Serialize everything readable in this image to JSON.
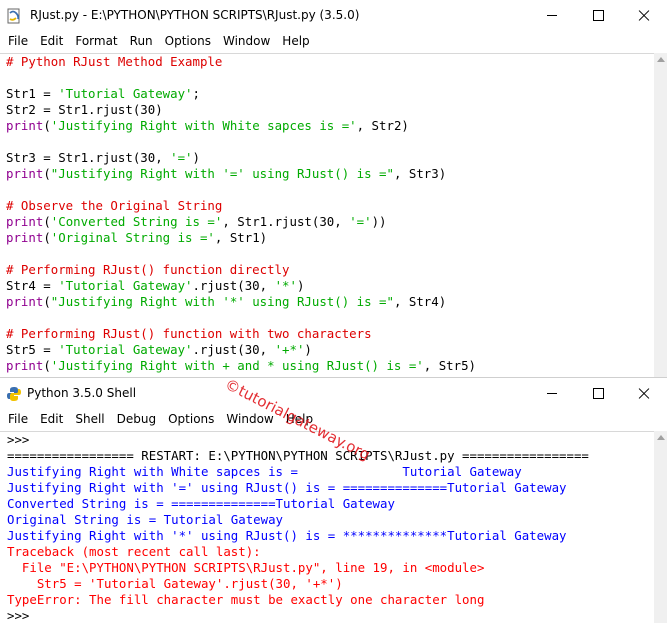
{
  "editor": {
    "title": "RJust.py - E:\\PYTHON\\PYTHON SCRIPTS\\RJust.py (3.5.0)",
    "menu": [
      "File",
      "Edit",
      "Format",
      "Run",
      "Options",
      "Window",
      "Help"
    ],
    "lines": [
      [
        {
          "c": "cm",
          "t": "# Python RJust Method Example"
        }
      ],
      [],
      [
        {
          "c": "no",
          "t": "Str1 = "
        },
        {
          "c": "st",
          "t": "'Tutorial Gateway'"
        },
        {
          "c": "no",
          "t": ";"
        }
      ],
      [
        {
          "c": "no",
          "t": "Str2 = Str1.rjust(30)"
        }
      ],
      [
        {
          "c": "bi",
          "t": "print"
        },
        {
          "c": "no",
          "t": "("
        },
        {
          "c": "st",
          "t": "'Justifying Right with White sapces is ='"
        },
        {
          "c": "no",
          "t": ", Str2)"
        }
      ],
      [],
      [
        {
          "c": "no",
          "t": "Str3 = Str1.rjust(30, "
        },
        {
          "c": "st",
          "t": "'='"
        },
        {
          "c": "no",
          "t": ")"
        }
      ],
      [
        {
          "c": "bi",
          "t": "print"
        },
        {
          "c": "no",
          "t": "("
        },
        {
          "c": "st",
          "t": "\"Justifying Right with '=' using RJust() is =\""
        },
        {
          "c": "no",
          "t": ", Str3)"
        }
      ],
      [],
      [
        {
          "c": "cm",
          "t": "# Observe the Original String"
        }
      ],
      [
        {
          "c": "bi",
          "t": "print"
        },
        {
          "c": "no",
          "t": "("
        },
        {
          "c": "st",
          "t": "'Converted String is ='"
        },
        {
          "c": "no",
          "t": ", Str1.rjust(30, "
        },
        {
          "c": "st",
          "t": "'='"
        },
        {
          "c": "no",
          "t": "))"
        }
      ],
      [
        {
          "c": "bi",
          "t": "print"
        },
        {
          "c": "no",
          "t": "("
        },
        {
          "c": "st",
          "t": "'Original String is ='"
        },
        {
          "c": "no",
          "t": ", Str1)"
        }
      ],
      [],
      [
        {
          "c": "cm",
          "t": "# Performing RJust() function directly"
        }
      ],
      [
        {
          "c": "no",
          "t": "Str4 = "
        },
        {
          "c": "st",
          "t": "'Tutorial Gateway'"
        },
        {
          "c": "no",
          "t": ".rjust(30, "
        },
        {
          "c": "st",
          "t": "'*'"
        },
        {
          "c": "no",
          "t": ")"
        }
      ],
      [
        {
          "c": "bi",
          "t": "print"
        },
        {
          "c": "no",
          "t": "("
        },
        {
          "c": "st",
          "t": "\"Justifying Right with '*' using RJust() is =\""
        },
        {
          "c": "no",
          "t": ", Str4)"
        }
      ],
      [],
      [
        {
          "c": "cm",
          "t": "# Performing RJust() function with two characters"
        }
      ],
      [
        {
          "c": "no",
          "t": "Str5 = "
        },
        {
          "c": "st",
          "t": "'Tutorial Gateway'"
        },
        {
          "c": "no",
          "t": ".rjust(30, "
        },
        {
          "c": "st",
          "t": "'+*'"
        },
        {
          "c": "no",
          "t": ")"
        }
      ],
      [
        {
          "c": "bi",
          "t": "print"
        },
        {
          "c": "no",
          "t": "("
        },
        {
          "c": "st",
          "t": "'Justifying Right with + and * using RJust() is ='"
        },
        {
          "c": "no",
          "t": ", Str5)"
        }
      ]
    ]
  },
  "shell": {
    "title": "Python 3.5.0 Shell",
    "menu": [
      "File",
      "Edit",
      "Shell",
      "Debug",
      "Options",
      "Window",
      "Help"
    ],
    "lines": [
      [
        {
          "c": "no",
          "t": ">>> "
        }
      ],
      [
        {
          "c": "no",
          "t": "================= RESTART: E:\\PYTHON\\PYTHON SCRIPTS\\RJust.py ================="
        }
      ],
      [
        {
          "c": "out",
          "t": "Justifying Right with White sapces is =              Tutorial Gateway"
        }
      ],
      [
        {
          "c": "out",
          "t": "Justifying Right with '=' using RJust() is = ==============Tutorial Gateway"
        }
      ],
      [
        {
          "c": "out",
          "t": "Converted String is = ==============Tutorial Gateway"
        }
      ],
      [
        {
          "c": "out",
          "t": "Original String is = Tutorial Gateway"
        }
      ],
      [
        {
          "c": "out",
          "t": "Justifying Right with '*' using RJust() is = **************Tutorial Gateway"
        }
      ],
      [
        {
          "c": "err",
          "t": "Traceback (most recent call last):"
        }
      ],
      [
        {
          "c": "err",
          "t": "  File \"E:\\PYTHON\\PYTHON SCRIPTS\\RJust.py\", line 19, in <module>"
        }
      ],
      [
        {
          "c": "err",
          "t": "    Str5 = 'Tutorial Gateway'.rjust(30, '+*')"
        }
      ],
      [
        {
          "c": "err",
          "t": "TypeError: The fill character must be exactly one character long"
        }
      ],
      [
        {
          "c": "no",
          "t": ">>> "
        }
      ]
    ]
  },
  "watermark": "©tutorialgateway.org"
}
